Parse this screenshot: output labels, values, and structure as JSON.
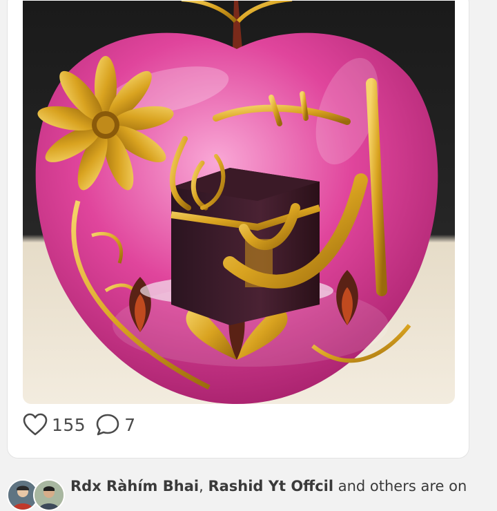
{
  "post": {
    "likes": "155",
    "comments": "7"
  },
  "activity": {
    "user1": "Rdx Ràhím Bhai",
    "separator": ", ",
    "user2": "Rashid Yt Offcil",
    "suffix": " and others are on"
  },
  "icons": {
    "like": "heart-outline-icon",
    "comment": "speech-bubble-icon"
  },
  "colors": {
    "apple_pink": "#e0459c",
    "gold": "#d9a320",
    "text_gray": "#4a4a4a",
    "card_bg": "#ffffff",
    "page_bg": "#f2f2f2"
  }
}
